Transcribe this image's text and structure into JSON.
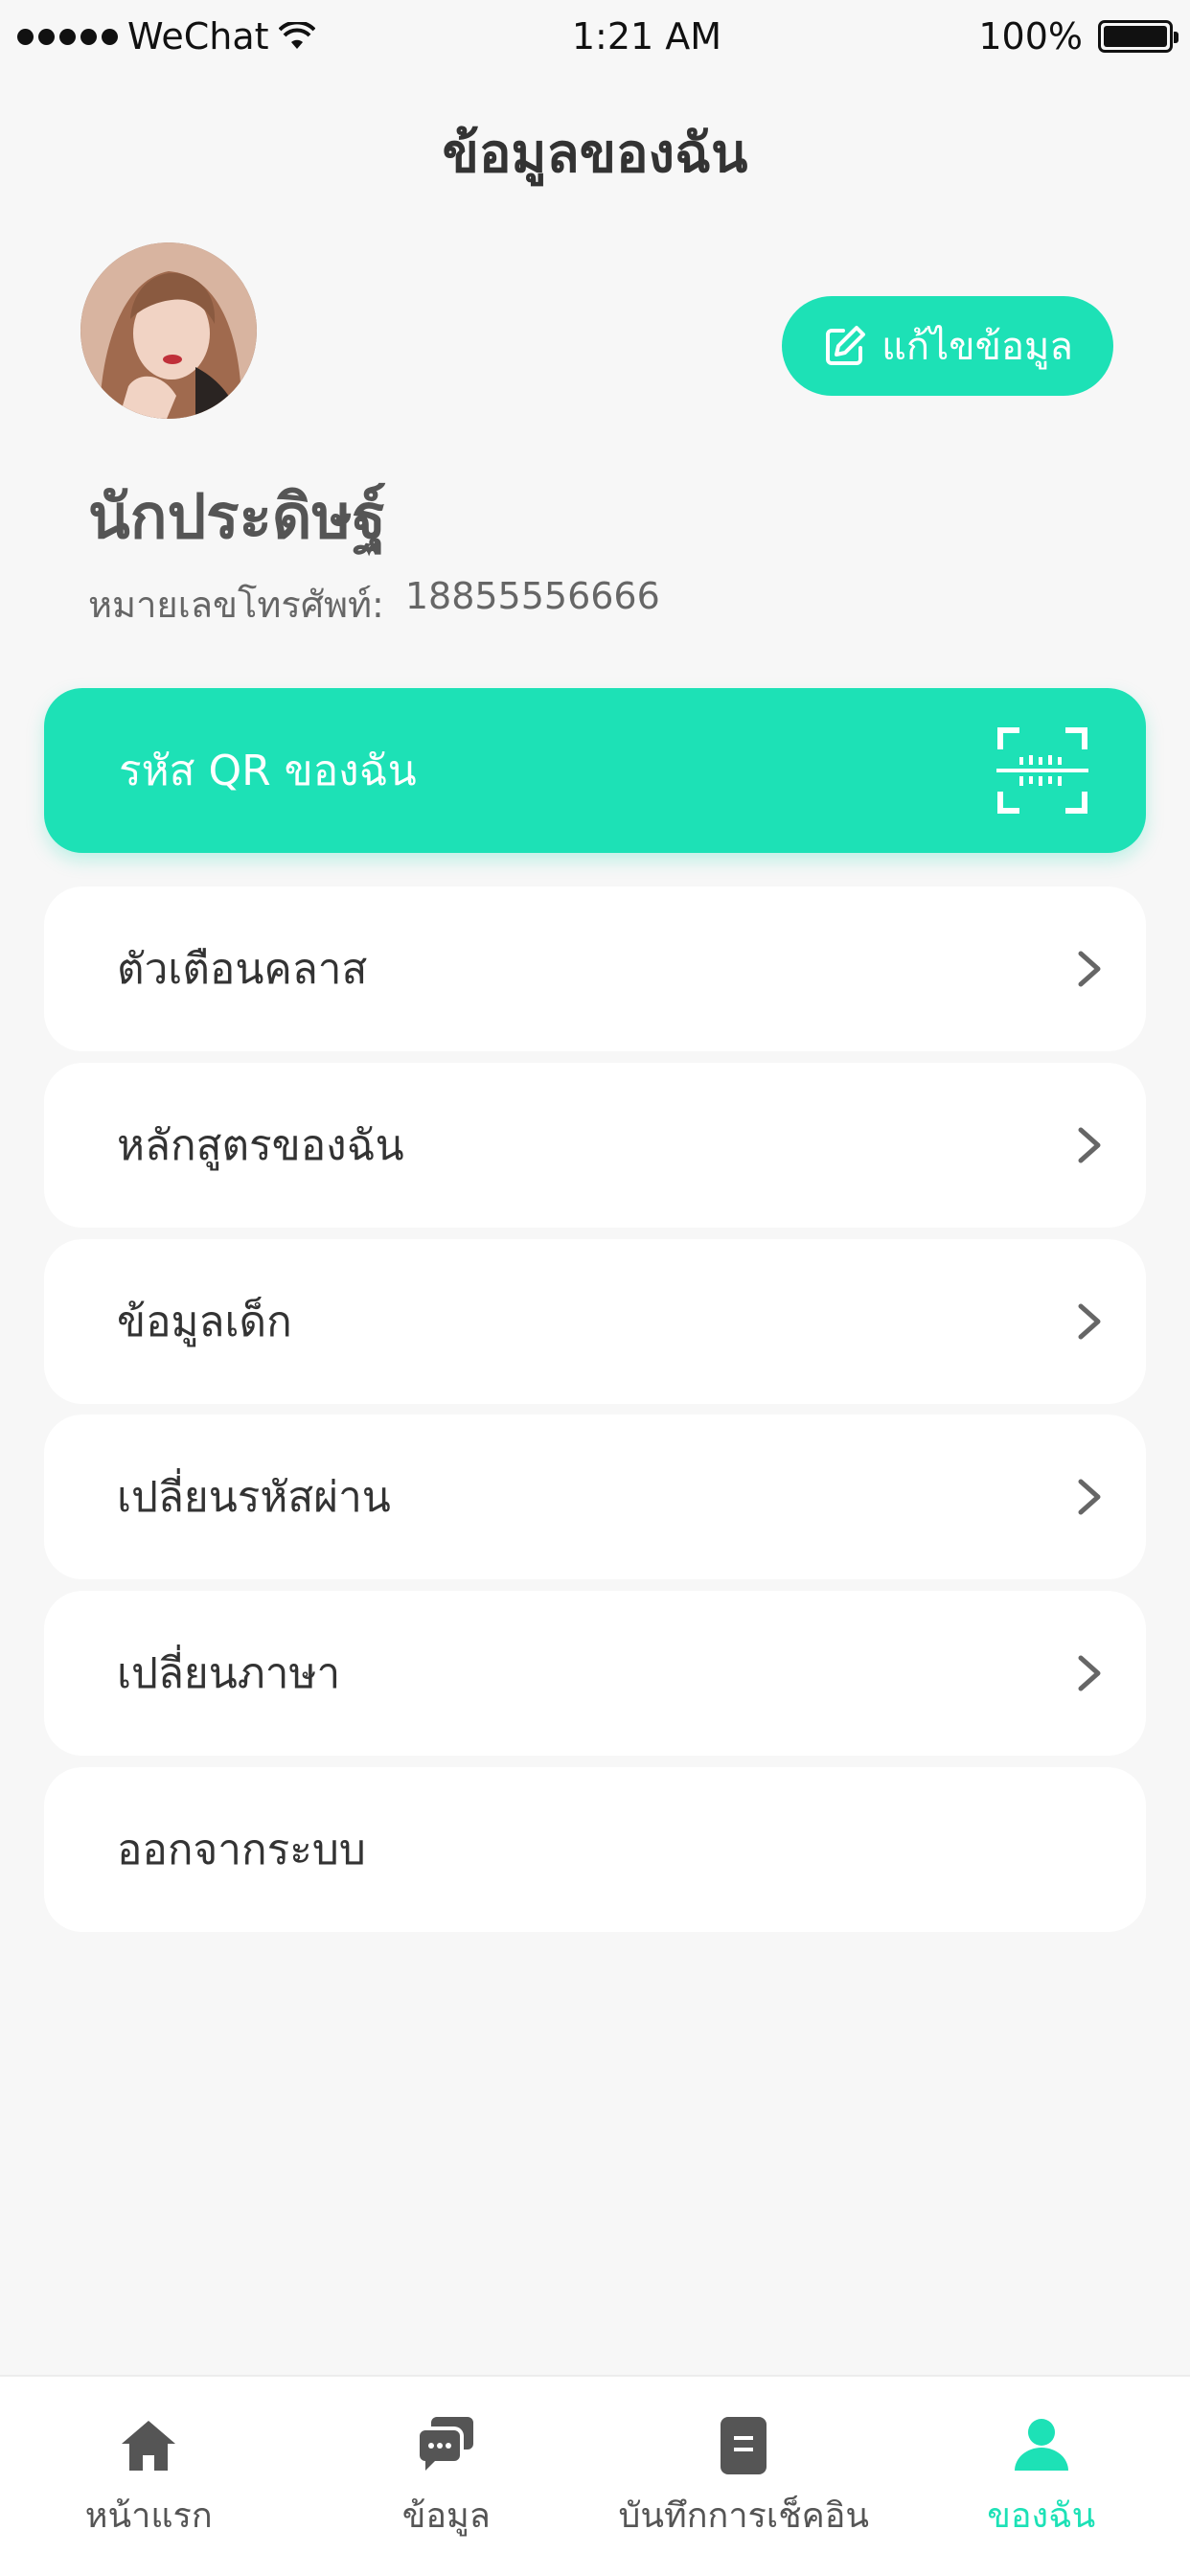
{
  "status_bar": {
    "carrier": "WeChat",
    "time": "1:21 AM",
    "battery": "100%"
  },
  "header": {
    "title": "ข้อมูลของฉัน"
  },
  "profile": {
    "edit_label": "แก้ไขข้อมูล",
    "name": "นักประดิษฐ์",
    "phone_label": "หมายเลขโทรศัพท์:",
    "phone_value": "18855556666"
  },
  "qr_card": {
    "label": "รหัส QR ของฉัน"
  },
  "menu": [
    {
      "label": "ตัวเตือนคลาส"
    },
    {
      "label": "หลักสูตรของฉัน"
    },
    {
      "label": "ข้อมูลเด็ก"
    },
    {
      "label": "เปลี่ยนรหัสผ่าน"
    },
    {
      "label": "เปลี่ยนภาษา"
    },
    {
      "label": "ออกจากระบบ"
    }
  ],
  "tabs": [
    {
      "label": "หน้าแรก",
      "icon": "home-icon"
    },
    {
      "label": "ข้อมูล",
      "icon": "chat-icon"
    },
    {
      "label": "บันทึกการเช็คอิน",
      "icon": "document-icon"
    },
    {
      "label": "ของฉัน",
      "icon": "user-icon",
      "active": true
    }
  ],
  "colors": {
    "accent": "#1de1b6",
    "background": "#f7f7f7",
    "card": "#ffffff"
  }
}
